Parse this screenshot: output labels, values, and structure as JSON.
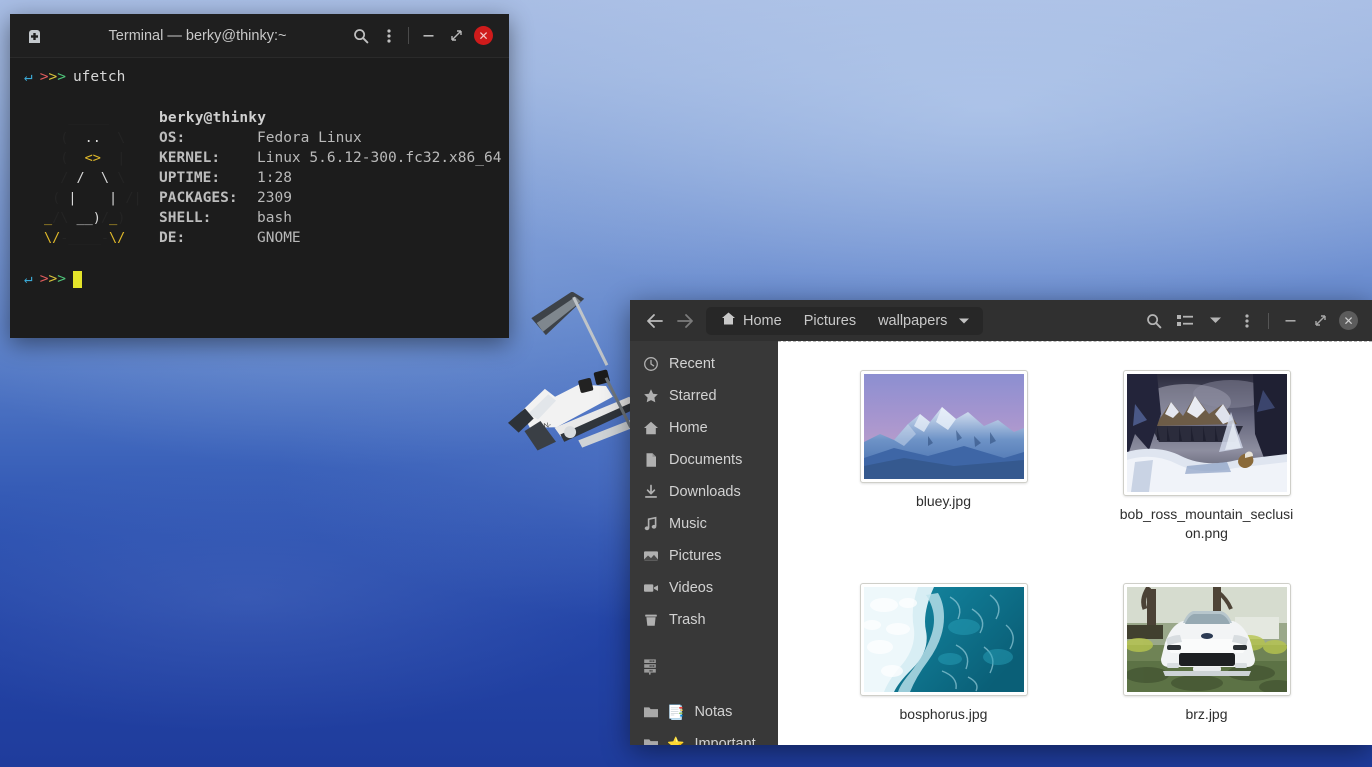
{
  "desktop": {
    "wallpaper_description": "blue sky with small white airplane",
    "sky_top_color": "#a8bde4",
    "sky_bottom_color": "#1f3c9c"
  },
  "terminal": {
    "title": "Terminal — berky@thinky:~",
    "icons": {
      "app": "terminal-add-icon",
      "search": "search-icon",
      "menu": "kebab-menu-icon",
      "minimize": "minimize-icon",
      "maximize": "restore-icon",
      "close": "close-icon"
    },
    "close_color": "#cf1b1b",
    "prompt": {
      "arrow": "↵",
      "chevrons": [
        ">",
        ">",
        ">"
      ]
    },
    "command": "ufetch",
    "fetch": {
      "user": "berky@thinky",
      "rows": [
        {
          "key": "OS:",
          "value": "Fedora Linux"
        },
        {
          "key": "KERNEL:",
          "value": "Linux 5.6.12-300.fc32.x86_64"
        },
        {
          "key": "UPTIME:",
          "value": "1:28"
        },
        {
          "key": "PACKAGES:",
          "value": "2309"
        },
        {
          "key": "SHELL:",
          "value": "bash"
        },
        {
          "key": "DE:",
          "value": "GNOME"
        }
      ],
      "ascii_art": "   _____\n  (  ..  \\\n  (  <>  |\n  / \\__/ \\ \\\n ( |    | /|\n_/\\ __)/_)\n\\/-____-\\/"
    }
  },
  "file_manager": {
    "nav": {
      "back": "back-arrow-icon",
      "forward": "forward-arrow-icon"
    },
    "breadcrumb": [
      {
        "label": "Home",
        "icon": "home-icon"
      },
      {
        "label": "Pictures",
        "icon": ""
      },
      {
        "label": "wallpapers",
        "icon": ""
      }
    ],
    "breadcrumb_dropdown": "chevron-down-icon",
    "header_buttons": [
      {
        "name": "search-icon"
      },
      {
        "name": "view-list-icon"
      },
      {
        "name": "chevron-down-icon"
      },
      {
        "name": "kebab-menu-icon"
      }
    ],
    "window_controls": {
      "minimize": "minimize-icon",
      "maximize": "restore-icon",
      "close": "close-icon"
    },
    "sidebar": [
      {
        "label": "Recent",
        "icon": "clock-icon"
      },
      {
        "label": "Starred",
        "icon": "star-icon"
      },
      {
        "label": "Home",
        "icon": "home-icon"
      },
      {
        "label": "Documents",
        "icon": "document-icon"
      },
      {
        "label": "Downloads",
        "icon": "download-icon"
      },
      {
        "label": "Music",
        "icon": "music-note-icon"
      },
      {
        "label": "Pictures",
        "icon": "picture-icon"
      },
      {
        "label": "Videos",
        "icon": "video-camera-icon"
      },
      {
        "label": "Trash",
        "icon": "trash-icon"
      }
    ],
    "sidebar_network": {
      "label": "",
      "icon": "server-icon"
    },
    "sidebar_bookmarks": [
      {
        "label": "Notas",
        "icon": "folder-icon",
        "emoji": "📑"
      },
      {
        "label": "Important",
        "icon": "folder-icon",
        "emoji": "⭐"
      }
    ],
    "files": [
      {
        "name": "bluey.jpg",
        "thumb": "mountain-dusk"
      },
      {
        "name": "bob_ross_mountain_seclusion.png",
        "thumb": "bob-ross-painting"
      },
      {
        "name": "bosphorus.jpg",
        "thumb": "sea-foam"
      },
      {
        "name": "brz.jpg",
        "thumb": "white-car"
      }
    ]
  }
}
